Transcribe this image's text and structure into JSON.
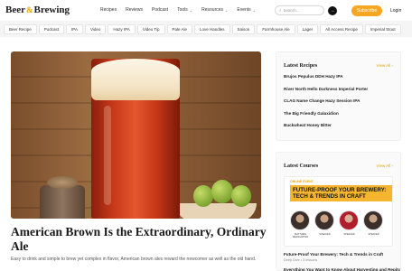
{
  "header": {
    "logo_left": "Beer",
    "logo_amp": "&",
    "logo_right": "Brewing",
    "nav": [
      {
        "label": "Recipes",
        "dropdown": false
      },
      {
        "label": "Reviews",
        "dropdown": false
      },
      {
        "label": "Podcast",
        "dropdown": false
      },
      {
        "label": "Tools",
        "dropdown": true
      },
      {
        "label": "Resources",
        "dropdown": true
      },
      {
        "label": "Events",
        "dropdown": true
      }
    ],
    "search_placeholder": "Search...",
    "subscribe_label": "Subscribe",
    "login_label": "Login",
    "accent_color": "#f5a623"
  },
  "tags": [
    "Beer Recipe",
    "Podcast",
    "IPA",
    "Video",
    "Hazy IPA",
    "Video Tip",
    "Pale Ale",
    "Love Handles",
    "Saison",
    "Farmhouse Ale",
    "Lager",
    "All Access Recipe",
    "Imperial Stout"
  ],
  "article": {
    "title": "American Brown Is the Extraordinary, Ordinary Ale",
    "description": "Easy to drink and simple to brew yet complex in flavor, American brown ales reward the newcomer as well as the old hand."
  },
  "latest_recipes": {
    "title": "Latest Recipes",
    "view_all": "View All",
    "items": [
      "Brujos Pepulus DDH Hazy IPA",
      "River North Hello Darkness Imperial Porter",
      "CLAG Name Change Hazy Session IPA",
      "The Big Friendly Galaxidion",
      "Buckwheat Honey Bitter"
    ]
  },
  "latest_courses": {
    "title": "Latest Courses",
    "view_all": "View All",
    "banner_live": "ONLINE EVENT",
    "banner_title": "FUTURE-PROOF YOUR BREWERY: TECH & TRENDS IN CRAFT",
    "banner_names": [
      "MATTHEW WEINGARTEN",
      "SPEAKER",
      "SPEAKER",
      "SPEAKER"
    ],
    "courses": [
      {
        "name": "Future-Proof Your Brewery: Tech & Trends in Craft",
        "meta": "Deep Dive • 3 lessons"
      },
      {
        "name": "Everything You Want to Know About Harvesting and Repitching Yeast",
        "meta": ""
      }
    ]
  }
}
